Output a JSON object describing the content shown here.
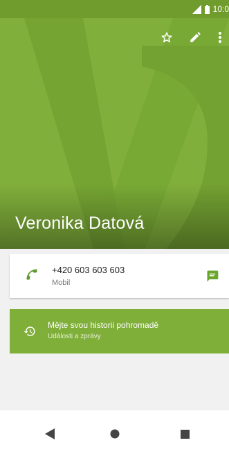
{
  "status_bar": {
    "time": "10:0"
  },
  "contact": {
    "name": "Veronika Datová",
    "phone_number": "+420 603 603 603",
    "phone_type": "Mobil"
  },
  "history": {
    "title": "Mějte svou historii pohromadě",
    "subtitle": "Události a zprávy"
  },
  "icons": {
    "favorite": "star-outline-icon",
    "edit": "pencil-icon",
    "more": "more-vert-icon",
    "call": "phone-icon",
    "message": "message-icon",
    "history": "history-icon"
  },
  "colors": {
    "accent": "#7fae39",
    "status_bar": "#6f9c2c",
    "phone_icon": "#5d9a2f"
  }
}
